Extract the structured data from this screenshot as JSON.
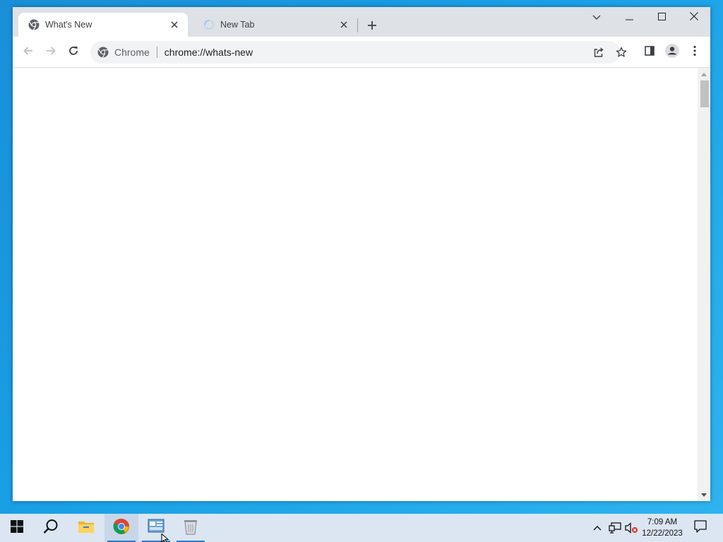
{
  "browser": {
    "tabs": [
      {
        "title": "What's New",
        "active": true,
        "icon": "chrome-icon"
      },
      {
        "title": "New Tab",
        "active": false,
        "icon": "loading-spinner-icon"
      }
    ],
    "address_bar": {
      "chip_label": "Chrome",
      "url": "chrome://whats-new"
    },
    "window_controls": [
      "tab-search-icon",
      "minimize-icon",
      "maximize-icon",
      "close-icon"
    ],
    "toolbar_icons": [
      "back-icon",
      "forward-icon",
      "reload-icon",
      "share-icon",
      "bookmark-star-icon",
      "side-panel-icon",
      "profile-icon",
      "menu-icon"
    ]
  },
  "taskbar": {
    "pinned": [
      "start-icon",
      "search-icon",
      "file-explorer-icon",
      "chrome-icon",
      "control-panel-icon",
      "recycle-bin-icon"
    ],
    "tray_icons": [
      "show-hidden-icons-icon",
      "network-icon",
      "volume-muted-icon"
    ],
    "clock": {
      "time": "7:09 AM",
      "date": "12/22/2023"
    }
  },
  "colors": {
    "desktop": "#1a9ae0",
    "tabstrip": "#dee1e6",
    "omnibox": "#f1f3f4",
    "taskbar": "#dbe6f2",
    "accent": "#2b7cd3"
  }
}
